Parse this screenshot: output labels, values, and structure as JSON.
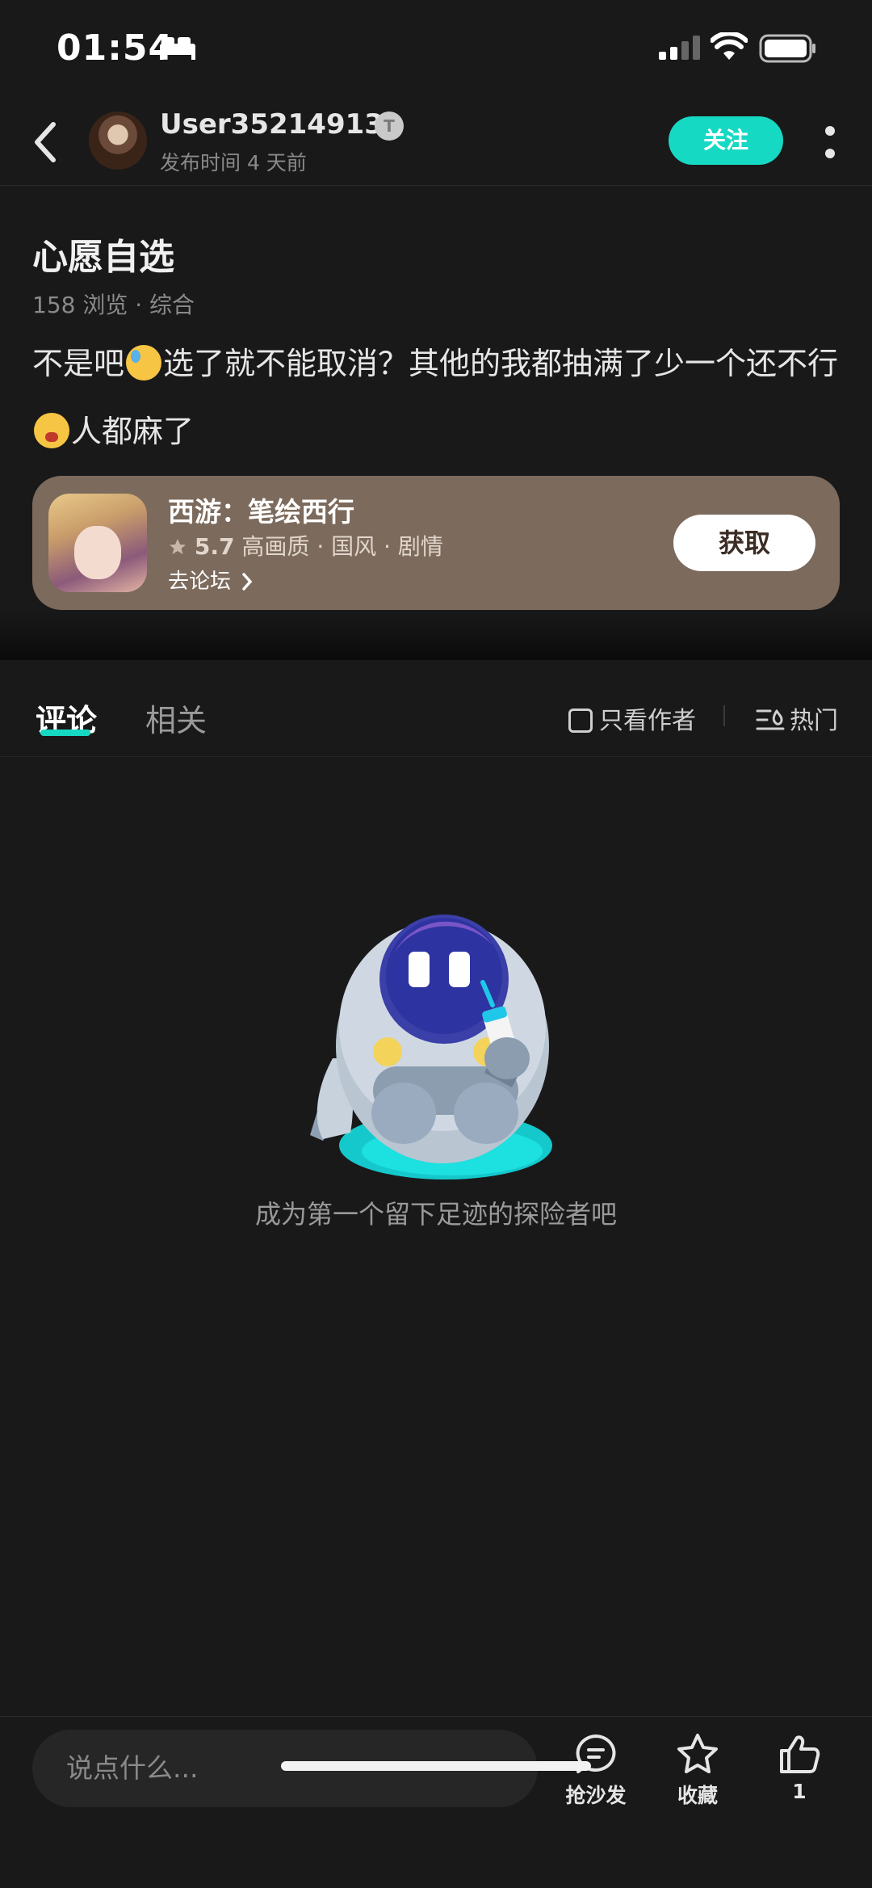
{
  "status_bar": {
    "time": "01:54"
  },
  "header": {
    "username": "User35214913",
    "level_badge": "T",
    "post_time": "发布时间 4 天前",
    "follow_label": "关注"
  },
  "post": {
    "title": "心愿自选",
    "meta": "158 浏览 · 综合",
    "body_part1": "不是吧",
    "body_part2": "选了就不能取消？其他的我都抽满了少一个还不行",
    "body_part3": "人都麻了"
  },
  "game_card": {
    "name": "西游：笔绘西行",
    "rating": "5.7",
    "tags": "高画质 · 国风 · 剧情",
    "forum_link": "去论坛",
    "get_label": "获取",
    "background_color": "#7c6a5c"
  },
  "tabs": {
    "comment": "评论",
    "related": "相关",
    "author_only": "只看作者",
    "sort": "热门",
    "accent_color": "#16d9c4"
  },
  "empty_state": {
    "text": "成为第一个留下足迹的探险者吧"
  },
  "bottom_bar": {
    "input_placeholder": "说点什么...",
    "sofa_label": "抢沙发",
    "favorite_label": "收藏",
    "like_count": "1"
  }
}
